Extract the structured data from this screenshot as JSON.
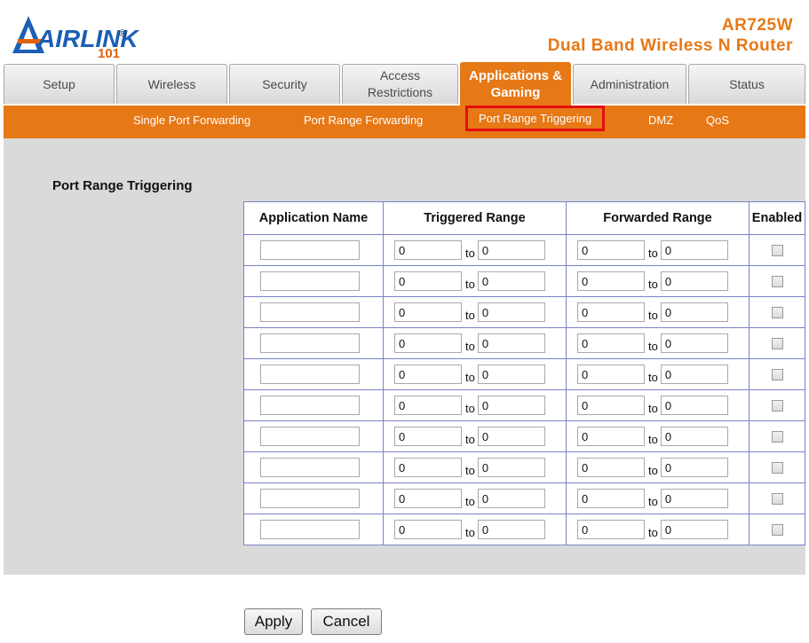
{
  "brand": {
    "logo_word": "AIRLINK",
    "logo_number": "101",
    "logo_reg": "®",
    "model": "AR725W",
    "product": "Dual Band Wireless N Router"
  },
  "tabs": [
    {
      "label": "Setup"
    },
    {
      "label": "Wireless"
    },
    {
      "label": "Security"
    },
    {
      "label": "Access Restrictions"
    },
    {
      "label": "Applications & Gaming",
      "active": true
    },
    {
      "label": "Administration"
    },
    {
      "label": "Status"
    }
  ],
  "subnav": [
    {
      "label": "Single Port Forwarding"
    },
    {
      "label": "Port Range Forwarding"
    },
    {
      "label": "Port Range Triggering",
      "selected": true
    },
    {
      "label": "DMZ"
    },
    {
      "label": "QoS"
    }
  ],
  "section_title": "Port Range Triggering",
  "table": {
    "headers": {
      "app": "Application Name",
      "trg": "Triggered Range",
      "fwd": "Forwarded Range",
      "en": "Enabled"
    },
    "to_label": "to",
    "rows": [
      {
        "app": "",
        "trg_start": "0",
        "trg_end": "0",
        "fwd_start": "0",
        "fwd_end": "0",
        "enabled": false
      },
      {
        "app": "",
        "trg_start": "0",
        "trg_end": "0",
        "fwd_start": "0",
        "fwd_end": "0",
        "enabled": false
      },
      {
        "app": "",
        "trg_start": "0",
        "trg_end": "0",
        "fwd_start": "0",
        "fwd_end": "0",
        "enabled": false
      },
      {
        "app": "",
        "trg_start": "0",
        "trg_end": "0",
        "fwd_start": "0",
        "fwd_end": "0",
        "enabled": false
      },
      {
        "app": "",
        "trg_start": "0",
        "trg_end": "0",
        "fwd_start": "0",
        "fwd_end": "0",
        "enabled": false
      },
      {
        "app": "",
        "trg_start": "0",
        "trg_end": "0",
        "fwd_start": "0",
        "fwd_end": "0",
        "enabled": false
      },
      {
        "app": "",
        "trg_start": "0",
        "trg_end": "0",
        "fwd_start": "0",
        "fwd_end": "0",
        "enabled": false
      },
      {
        "app": "",
        "trg_start": "0",
        "trg_end": "0",
        "fwd_start": "0",
        "fwd_end": "0",
        "enabled": false
      },
      {
        "app": "",
        "trg_start": "0",
        "trg_end": "0",
        "fwd_start": "0",
        "fwd_end": "0",
        "enabled": false
      },
      {
        "app": "",
        "trg_start": "0",
        "trg_end": "0",
        "fwd_start": "0",
        "fwd_end": "0",
        "enabled": false
      }
    ]
  },
  "buttons": {
    "apply": "Apply",
    "cancel": "Cancel"
  },
  "colors": {
    "accent": "#e77816",
    "highlight_box": "#e40e0e",
    "table_border": "#7b82c6",
    "panel_bg": "#dadada"
  }
}
